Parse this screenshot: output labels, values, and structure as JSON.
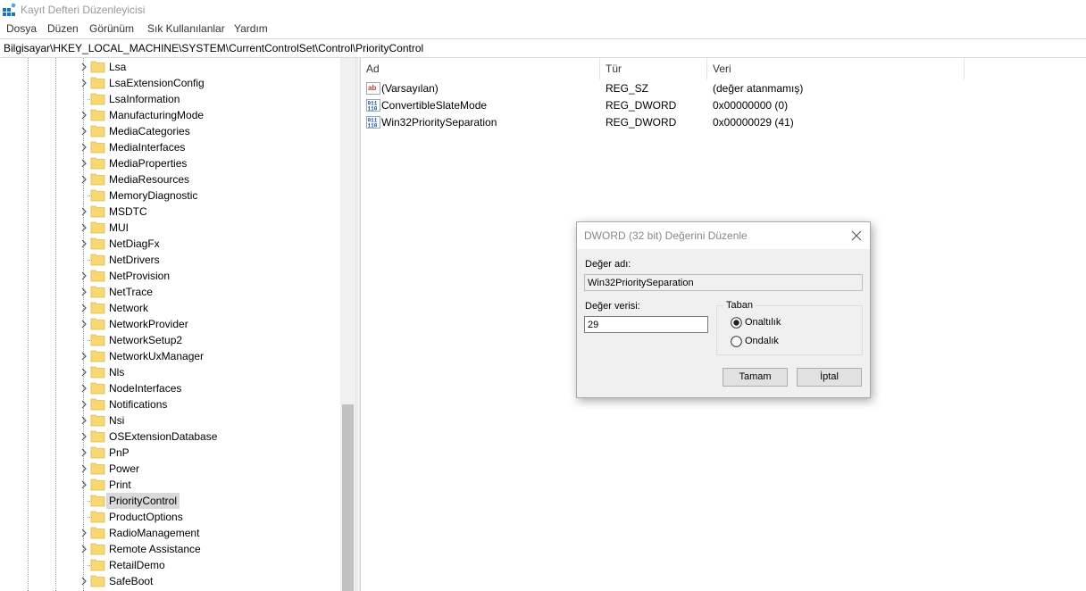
{
  "window": {
    "title": "Kayıt Defteri Düzenleyicisi",
    "icon": "registry-editor-icon"
  },
  "menu": [
    "Dosya",
    "Düzen",
    "Görünüm",
    "Sık Kullanılanlar",
    "Yardım"
  ],
  "address": "Bilgisayar\\HKEY_LOCAL_MACHINE\\SYSTEM\\CurrentControlSet\\Control\\PriorityControl",
  "tree": {
    "items": [
      {
        "label": "Lsa",
        "expandable": true
      },
      {
        "label": "LsaExtensionConfig",
        "expandable": true
      },
      {
        "label": "LsaInformation",
        "expandable": false
      },
      {
        "label": "ManufacturingMode",
        "expandable": true
      },
      {
        "label": "MediaCategories",
        "expandable": true
      },
      {
        "label": "MediaInterfaces",
        "expandable": true
      },
      {
        "label": "MediaProperties",
        "expandable": true
      },
      {
        "label": "MediaResources",
        "expandable": true
      },
      {
        "label": "MemoryDiagnostic",
        "expandable": false
      },
      {
        "label": "MSDTC",
        "expandable": true
      },
      {
        "label": "MUI",
        "expandable": true
      },
      {
        "label": "NetDiagFx",
        "expandable": true
      },
      {
        "label": "NetDrivers",
        "expandable": false
      },
      {
        "label": "NetProvision",
        "expandable": true
      },
      {
        "label": "NetTrace",
        "expandable": true
      },
      {
        "label": "Network",
        "expandable": true
      },
      {
        "label": "NetworkProvider",
        "expandable": true
      },
      {
        "label": "NetworkSetup2",
        "expandable": false
      },
      {
        "label": "NetworkUxManager",
        "expandable": true
      },
      {
        "label": "Nls",
        "expandable": true
      },
      {
        "label": "NodeInterfaces",
        "expandable": true
      },
      {
        "label": "Notifications",
        "expandable": true
      },
      {
        "label": "Nsi",
        "expandable": true
      },
      {
        "label": "OSExtensionDatabase",
        "expandable": true
      },
      {
        "label": "PnP",
        "expandable": true
      },
      {
        "label": "Power",
        "expandable": true
      },
      {
        "label": "Print",
        "expandable": true
      },
      {
        "label": "PriorityControl",
        "expandable": false,
        "selected": true
      },
      {
        "label": "ProductOptions",
        "expandable": false
      },
      {
        "label": "RadioManagement",
        "expandable": true
      },
      {
        "label": "Remote Assistance",
        "expandable": true
      },
      {
        "label": "RetailDemo",
        "expandable": false
      },
      {
        "label": "SafeBoot",
        "expandable": true
      }
    ]
  },
  "list": {
    "columns": [
      "Ad",
      "Tür",
      "Veri"
    ],
    "rows": [
      {
        "icon": "string-value-icon",
        "name": "(Varsayılan)",
        "type": "REG_SZ",
        "data": "(değer atanmamış)"
      },
      {
        "icon": "binary-value-icon",
        "name": "ConvertibleSlateMode",
        "type": "REG_DWORD",
        "data": "0x00000000 (0)"
      },
      {
        "icon": "binary-value-icon",
        "name": "Win32PrioritySeparation",
        "type": "REG_DWORD",
        "data": "0x00000029 (41)"
      }
    ]
  },
  "dialog": {
    "title": "DWORD (32 bit) Değerini Düzenle",
    "name_label": "Değer adı:",
    "name_value": "Win32PrioritySeparation",
    "data_label": "Değer verisi:",
    "data_value": "29",
    "base_label": "Taban",
    "radio_hex": "Onaltılık",
    "radio_dec": "Ondalık",
    "selected_base": "Onaltılık",
    "ok_label": "Tamam",
    "cancel_label": "İptal"
  },
  "colors": {
    "folder": "#f8d775",
    "selection": "#d9d9d9",
    "dialog_bg": "#f0f0f0"
  }
}
